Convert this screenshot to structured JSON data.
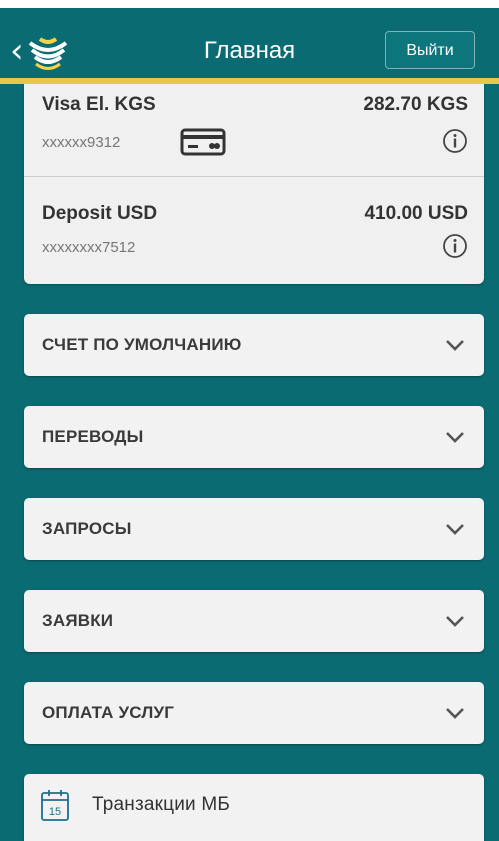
{
  "header": {
    "title": "Главная",
    "logout_label": "Выйти",
    "back_icon": "chevron-left-icon",
    "logo_icon": "bank-logo-icon"
  },
  "accounts": [
    {
      "name": "Visa El. KGS",
      "number": "xxxxxx9312",
      "amount": "282.70 KGS",
      "has_card_icon": true
    },
    {
      "name": "Deposit USD",
      "number": "xxxxxxxx7512",
      "amount": "410.00 USD",
      "has_card_icon": false
    }
  ],
  "sections": [
    {
      "label": "СЧЕТ ПО УМОЛЧАНИЮ"
    },
    {
      "label": "ПЕРЕВОДЫ"
    },
    {
      "label": "ЗАПРОСЫ"
    },
    {
      "label": "ЗАЯВКИ"
    },
    {
      "label": "ОПЛАТА УСЛУГ"
    }
  ],
  "transactions": {
    "label": "Транзакции МБ",
    "calendar_day": "15"
  },
  "colors": {
    "header_bg": "#0b6b72",
    "accent_line": "#e6c74a",
    "card_bg": "#f2f2f2"
  }
}
